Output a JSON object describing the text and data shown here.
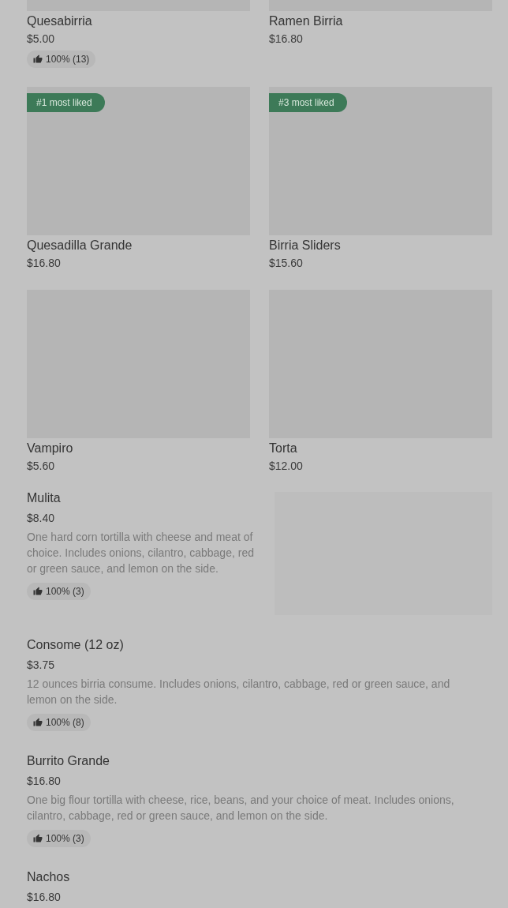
{
  "grid_items": [
    {
      "name": "Quesabirria",
      "price": "$5.00",
      "rating": "100% (13)"
    },
    {
      "name": "Ramen Birria",
      "price": "$16.80"
    },
    {
      "name": "Quesadilla Grande",
      "price": "$16.80",
      "badge": "#1 most liked"
    },
    {
      "name": "Birria Sliders",
      "price": "$15.60",
      "badge": "#3 most liked"
    },
    {
      "name": "Vampiro",
      "price": "$5.60"
    },
    {
      "name": "Torta",
      "price": "$12.00"
    }
  ],
  "list_items": [
    {
      "name": "Mulita",
      "price": "$8.40",
      "description": "One hard corn tortilla with cheese and meat of choice. Includes onions, cilantro, cabbage, red or green sauce, and lemon on the side.",
      "rating": "100% (3)",
      "has_image": true
    },
    {
      "name": "Consome (12 oz)",
      "price": "$3.75",
      "description": "12 ounces birria consume. Includes onions, cilantro, cabbage, red or green sauce, and lemon on the side.",
      "rating": "100% (8)",
      "has_image": false
    },
    {
      "name": "Burrito Grande",
      "price": "$16.80",
      "description": "One big flour tortilla with cheese, rice, beans, and your choice of meat. Includes onions, cilantro, cabbage, red or green sauce, and lemon on the side.",
      "rating": "100% (3)",
      "has_image": false
    },
    {
      "name": "Nachos",
      "price": "$16.80",
      "has_image": false
    }
  ]
}
